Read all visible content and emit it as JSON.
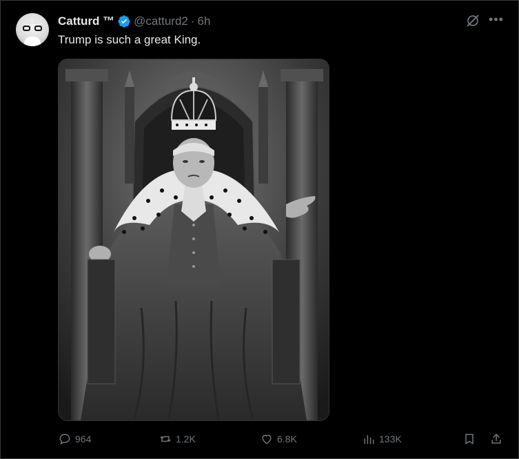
{
  "tweet": {
    "author": {
      "display_name": "Catturd ™",
      "handle": "@catturd2",
      "verified": true,
      "avatar_icon": "glasses-cat-avatar"
    },
    "separator": "·",
    "time": "6h",
    "text": "Trump is such a great King.",
    "media": {
      "kind": "image",
      "alt_icon": "king-on-throne-illustration"
    },
    "metrics": {
      "replies": "964",
      "reposts": "1.2K",
      "likes": "6.8K",
      "views": "133K"
    }
  },
  "colors": {
    "background": "#000000",
    "text_primary": "#e7e9ea",
    "text_secondary": "#71767b",
    "verified_blue": "#1d9bf0",
    "border": "#2f3336"
  },
  "icons": {
    "grok": "grok-icon",
    "more": "more-icon",
    "reply": "reply-icon",
    "repost": "repost-icon",
    "like": "heart-icon",
    "views": "views-icon",
    "bookmark": "bookmark-icon",
    "share": "share-icon"
  }
}
